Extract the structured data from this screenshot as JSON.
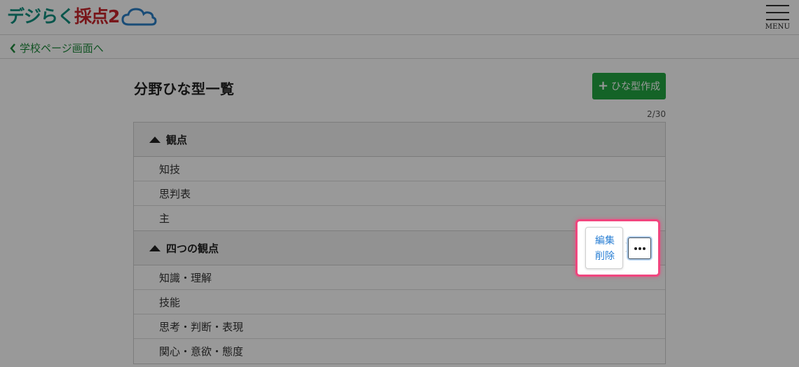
{
  "header": {
    "logo_part1": "デジらく",
    "logo_part2": "採点2",
    "menu_label": "MENU"
  },
  "breadcrumb": {
    "back_label": "学校ページ画面へ"
  },
  "page": {
    "title": "分野ひな型一覧",
    "create_button_label": "ひな型作成",
    "count": "2/30"
  },
  "groups": [
    {
      "name": "観点",
      "items": [
        "知技",
        "思判表",
        "主"
      ]
    },
    {
      "name": "四つの観点",
      "items": [
        "知識・理解",
        "技能",
        "思考・判断・表現",
        "関心・意欲・態度"
      ]
    }
  ],
  "popover": {
    "edit_label": "編集",
    "delete_label": "削除"
  },
  "colors": {
    "brand_green": "#22a542",
    "link_green": "#1e8a3c",
    "highlight_pink": "#f0457e",
    "link_blue": "#2a7fd4"
  }
}
